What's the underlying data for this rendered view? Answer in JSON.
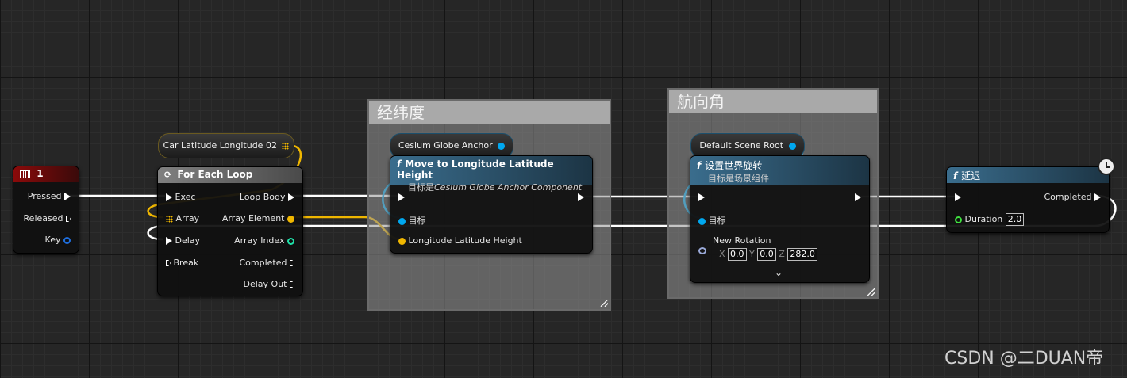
{
  "comments": [
    {
      "title": "经纬度"
    },
    {
      "title": "航向角"
    }
  ],
  "key_event": {
    "title": "1",
    "pins": {
      "pressed": "Pressed",
      "released": "Released",
      "key": "Key"
    }
  },
  "var_car": {
    "label": "Car Latitude Longitude 02"
  },
  "foreach": {
    "title": "For Each Loop",
    "inputs": {
      "exec": "Exec",
      "array": "Array",
      "delay": "Delay",
      "break": "Break"
    },
    "outputs": {
      "loop_body": "Loop Body",
      "array_element": "Array Element",
      "array_index": "Array Index",
      "completed": "Completed",
      "delay_out": "Delay Out"
    }
  },
  "var_anchor": {
    "label": "Cesium Globe Anchor"
  },
  "move_node": {
    "title": "Move to Longitude Latitude Height",
    "subtitle_prefix": "目标是",
    "subtitle_italic": "Cesium Globe Anchor Component",
    "pins": {
      "target": "目标",
      "llh": "Longitude Latitude Height"
    }
  },
  "var_root": {
    "label": "Default Scene Root"
  },
  "rot_node": {
    "title": "设置世界旋转",
    "subtitle": "目标是场景组件",
    "pins": {
      "target": "目标",
      "new_rotation": "New Rotation"
    },
    "rotation": {
      "x_label": "X",
      "x": "0.0",
      "y_label": "Y",
      "y": "0.0",
      "z_label": "Z",
      "z": "282.0"
    }
  },
  "delay_node": {
    "title": "延迟",
    "pins": {
      "completed": "Completed",
      "duration": "Duration"
    },
    "duration_value": "2.0"
  },
  "watermark": "CSDN @二DUAN帝",
  "colors": {
    "exec": "#ffffff",
    "object_pin": "#00a8f0",
    "struct_pin": "#f0b700",
    "int_pin": "#1fe0a8",
    "float_pin": "#3fe03f",
    "key_pin": "#1e6fe0",
    "event_header": "#8b0a0a",
    "function_header": "#3a6d8d"
  }
}
